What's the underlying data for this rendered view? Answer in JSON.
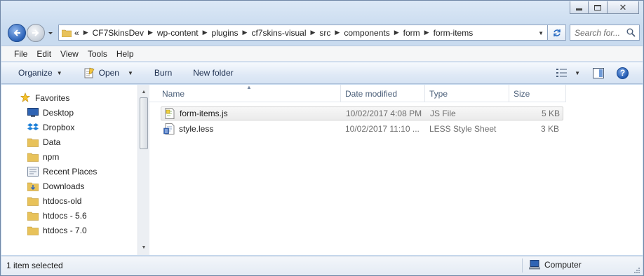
{
  "navigation": {
    "breadcrumb_overflow": "«",
    "breadcrumbs": [
      "CF7SkinsDev",
      "wp-content",
      "plugins",
      "cf7skins-visual",
      "src",
      "components",
      "form",
      "form-items"
    ],
    "search_placeholder": "Search for..."
  },
  "menu": {
    "items": [
      "File",
      "Edit",
      "View",
      "Tools",
      "Help"
    ]
  },
  "commands": {
    "organize": "Organize",
    "open": "Open",
    "burn": "Burn",
    "new_folder": "New folder",
    "help": "?"
  },
  "sidebar": {
    "items": [
      {
        "label": "Favorites",
        "icon": "star-icon"
      },
      {
        "label": "Desktop",
        "icon": "desktop-icon"
      },
      {
        "label": "Dropbox",
        "icon": "dropbox-icon"
      },
      {
        "label": "Data",
        "icon": "folder-icon"
      },
      {
        "label": "npm",
        "icon": "folder-icon"
      },
      {
        "label": "Recent Places",
        "icon": "recent-places-icon"
      },
      {
        "label": "Downloads",
        "icon": "downloads-icon"
      },
      {
        "label": "htdocs-old",
        "icon": "folder-icon"
      },
      {
        "label": "htdocs - 5.6",
        "icon": "folder-icon"
      },
      {
        "label": "htdocs - 7.0",
        "icon": "folder-icon"
      }
    ]
  },
  "columns": {
    "name": "Name",
    "date": "Date modified",
    "type": "Type",
    "size": "Size"
  },
  "files": [
    {
      "name": "form-items.js",
      "date": "10/02/2017 4:08 PM",
      "type": "JS File",
      "size": "5 KB",
      "icon": "js-file-icon",
      "selected": true
    },
    {
      "name": "style.less",
      "date": "10/02/2017 11:10 ...",
      "type": "LESS Style Sheet",
      "size": "3 KB",
      "icon": "less-file-icon",
      "selected": false
    }
  ],
  "status": {
    "selection": "1 item selected",
    "location": "Computer"
  },
  "colors": {
    "chrome": "#c9dbef",
    "accent": "#2b62b8",
    "folder": "#e8c25a"
  }
}
